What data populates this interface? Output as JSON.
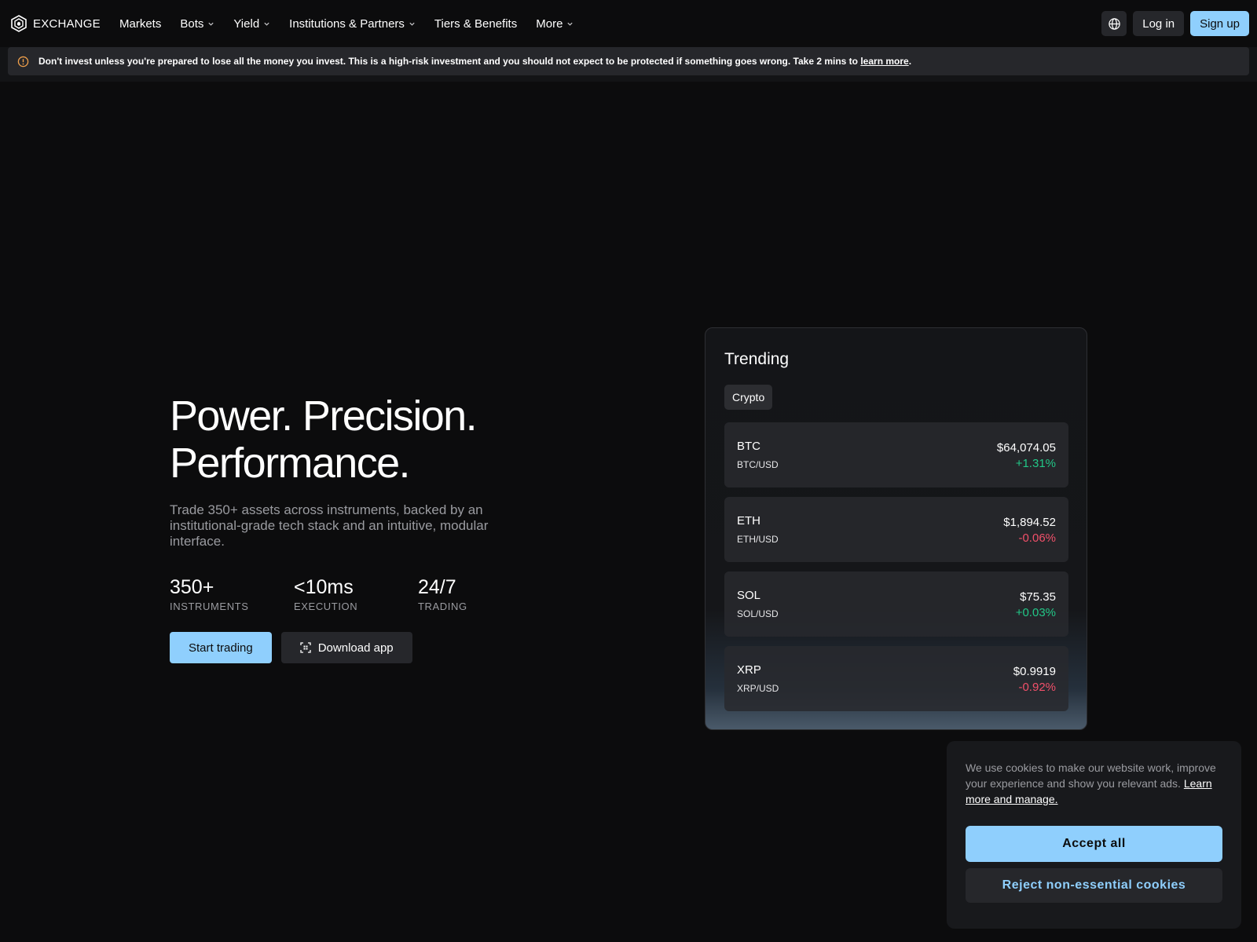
{
  "brand": {
    "name": "EXCHANGE"
  },
  "nav": {
    "items": [
      {
        "label": "Markets",
        "dropdown": false
      },
      {
        "label": "Bots",
        "dropdown": true
      },
      {
        "label": "Yield",
        "dropdown": true
      },
      {
        "label": "Institutions & Partners",
        "dropdown": true
      },
      {
        "label": "Tiers & Benefits",
        "dropdown": false
      },
      {
        "label": "More",
        "dropdown": true
      }
    ],
    "login": "Log in",
    "signup": "Sign up"
  },
  "risk_banner": {
    "text": "Don't invest unless you're prepared to lose all the money you invest. This is a high-risk investment and you should not expect to be protected if something goes wrong. Take 2 mins to ",
    "link": "learn more",
    "suffix": "."
  },
  "hero": {
    "title_line1": "Power. Precision.",
    "title_line2": "Performance.",
    "subtitle": "Trade 350+ assets across instruments, backed by an institutional-grade tech stack and an intuitive, modular interface.",
    "stats": [
      {
        "value": "350+",
        "label": "INSTRUMENTS"
      },
      {
        "value": "<10ms",
        "label": "EXECUTION"
      },
      {
        "value": "24/7",
        "label": "TRADING"
      }
    ],
    "start_button": "Start trading",
    "download_button": "Download app"
  },
  "trending": {
    "title": "Trending",
    "tab": "Crypto",
    "rows": [
      {
        "symbol": "BTC",
        "pair": "BTC/USD",
        "price": "$64,074.05",
        "change": "+1.31%",
        "direction": "up"
      },
      {
        "symbol": "ETH",
        "pair": "ETH/USD",
        "price": "$1,894.52",
        "change": "-0.06%",
        "direction": "down"
      },
      {
        "symbol": "SOL",
        "pair": "SOL/USD",
        "price": "$75.35",
        "change": "+0.03%",
        "direction": "up"
      },
      {
        "symbol": "XRP",
        "pair": "XRP/USD",
        "price": "$0.9919",
        "change": "-0.92%",
        "direction": "down"
      }
    ]
  },
  "cookie": {
    "text": "We use cookies to make our website work, improve your experience and show you relevant ads. ",
    "link": "Learn more and manage.",
    "accept": "Accept all",
    "reject": "Reject non-essential cookies"
  },
  "colors": {
    "background": "#0c0c0d",
    "accent": "#8fcffd",
    "positive": "#22c787",
    "negative": "#f2506a",
    "warning": "#f0a04b"
  }
}
